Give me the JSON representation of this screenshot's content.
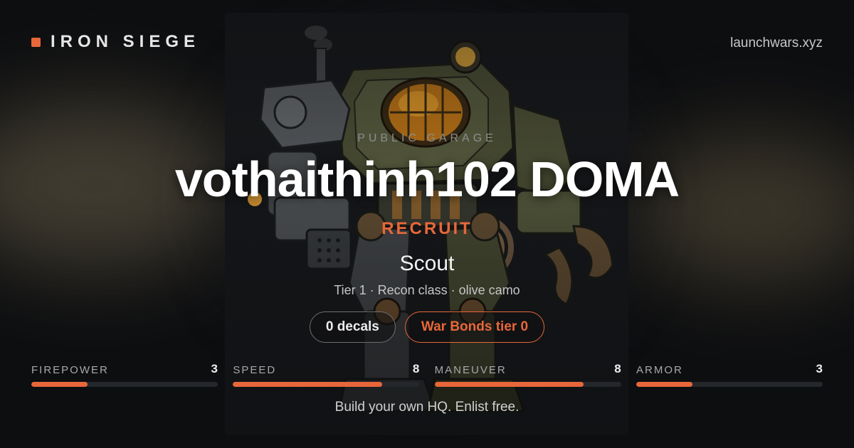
{
  "header": {
    "brand": "IRON SIEGE",
    "domain": "launchwars.xyz"
  },
  "hero": {
    "eyebrow": "PUBLIC GARAGE",
    "title": "vothaithinh102 DOMA",
    "rank": "RECRUIT",
    "unit_name": "Scout",
    "meta": "Tier 1 · Recon class · olive camo"
  },
  "pills": [
    {
      "label": "0 decals",
      "style": "grey"
    },
    {
      "label": "War Bonds tier 0",
      "style": "orange"
    }
  ],
  "stats": [
    {
      "label": "FIREPOWER",
      "value": "3",
      "level": 0.3
    },
    {
      "label": "SPEED",
      "value": "8",
      "level": 0.8
    },
    {
      "label": "MANEUVER",
      "value": "8",
      "level": 0.8
    },
    {
      "label": "ARMOR",
      "value": "3",
      "level": 0.3
    }
  ],
  "footer": {
    "tagline": "Build your own HQ. Enlist free."
  },
  "colors": {
    "accent": "#e8673a",
    "background": "#0d0e10",
    "track": "#24272b"
  },
  "icons": {
    "brand": "square-brand-icon",
    "art": "steampunk-mech-illustration"
  }
}
